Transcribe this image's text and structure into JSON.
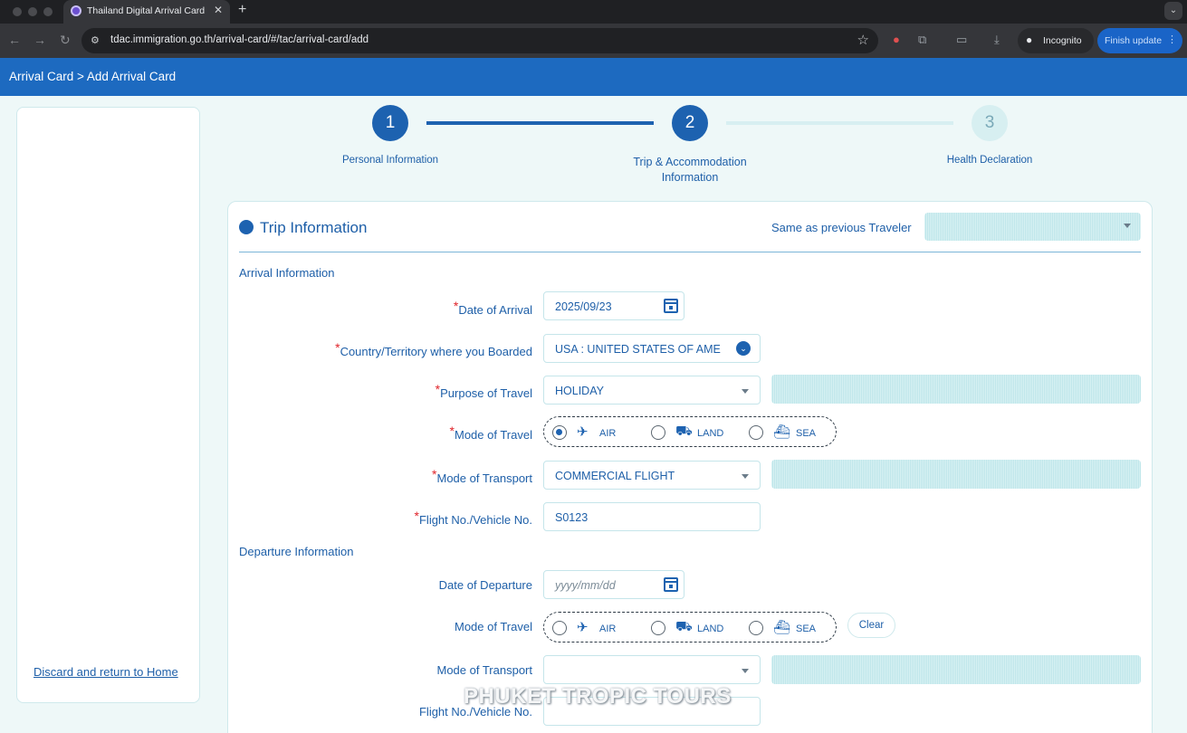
{
  "browser": {
    "tab_title": "Thailand Digital Arrival Card",
    "url": "tdac.immigration.go.th/arrival-card/#/tac/arrival-card/add",
    "incognito_label": "Incognito",
    "finish_update_label": "Finish update",
    "accent": "#1a64c7"
  },
  "header": {
    "breadcrumb": "Arrival Card > Add Arrival Card",
    "bg_color": "#1d6ac0"
  },
  "sidebar": {
    "discard_link": "Discard and return to Home"
  },
  "stepper": {
    "steps": [
      {
        "number": "1",
        "label": "Personal Information",
        "state": "done"
      },
      {
        "number": "2",
        "label": "Trip & Accommodation Information",
        "state": "active"
      },
      {
        "number": "3",
        "label": "Health Declaration",
        "state": "pending"
      }
    ]
  },
  "trip": {
    "title": "Trip Information",
    "same_as_previous_label": "Same as previous Traveler",
    "arrival": {
      "section_title": "Arrival Information",
      "date_label": "Date of Arrival",
      "date_value": "2025/09/23",
      "country_label": "Country/Territory where you Boarded",
      "country_value": "USA : UNITED STATES OF AME",
      "purpose_label": "Purpose of Travel",
      "purpose_value": "HOLIDAY",
      "mode_label": "Mode of Travel",
      "mode_options": [
        "AIR",
        "LAND",
        "SEA"
      ],
      "mode_selected": "AIR",
      "transport_label": "Mode of Transport",
      "transport_value": "COMMERCIAL FLIGHT",
      "flight_label": "Flight No./Vehicle No.",
      "flight_value": "S0123"
    },
    "departure": {
      "section_title": "Departure Information",
      "date_label": "Date of Departure",
      "date_placeholder": "yyyy/mm/dd",
      "mode_label": "Mode of Travel",
      "mode_options": [
        "AIR",
        "LAND",
        "SEA"
      ],
      "clear_label": "Clear",
      "transport_label": "Mode of Transport",
      "flight_label": "Flight No./Vehicle No."
    }
  },
  "watermark": "PHUKET TROPIC TOURS",
  "colors": {
    "primary": "#1d62b0",
    "required": "#e0242a"
  }
}
